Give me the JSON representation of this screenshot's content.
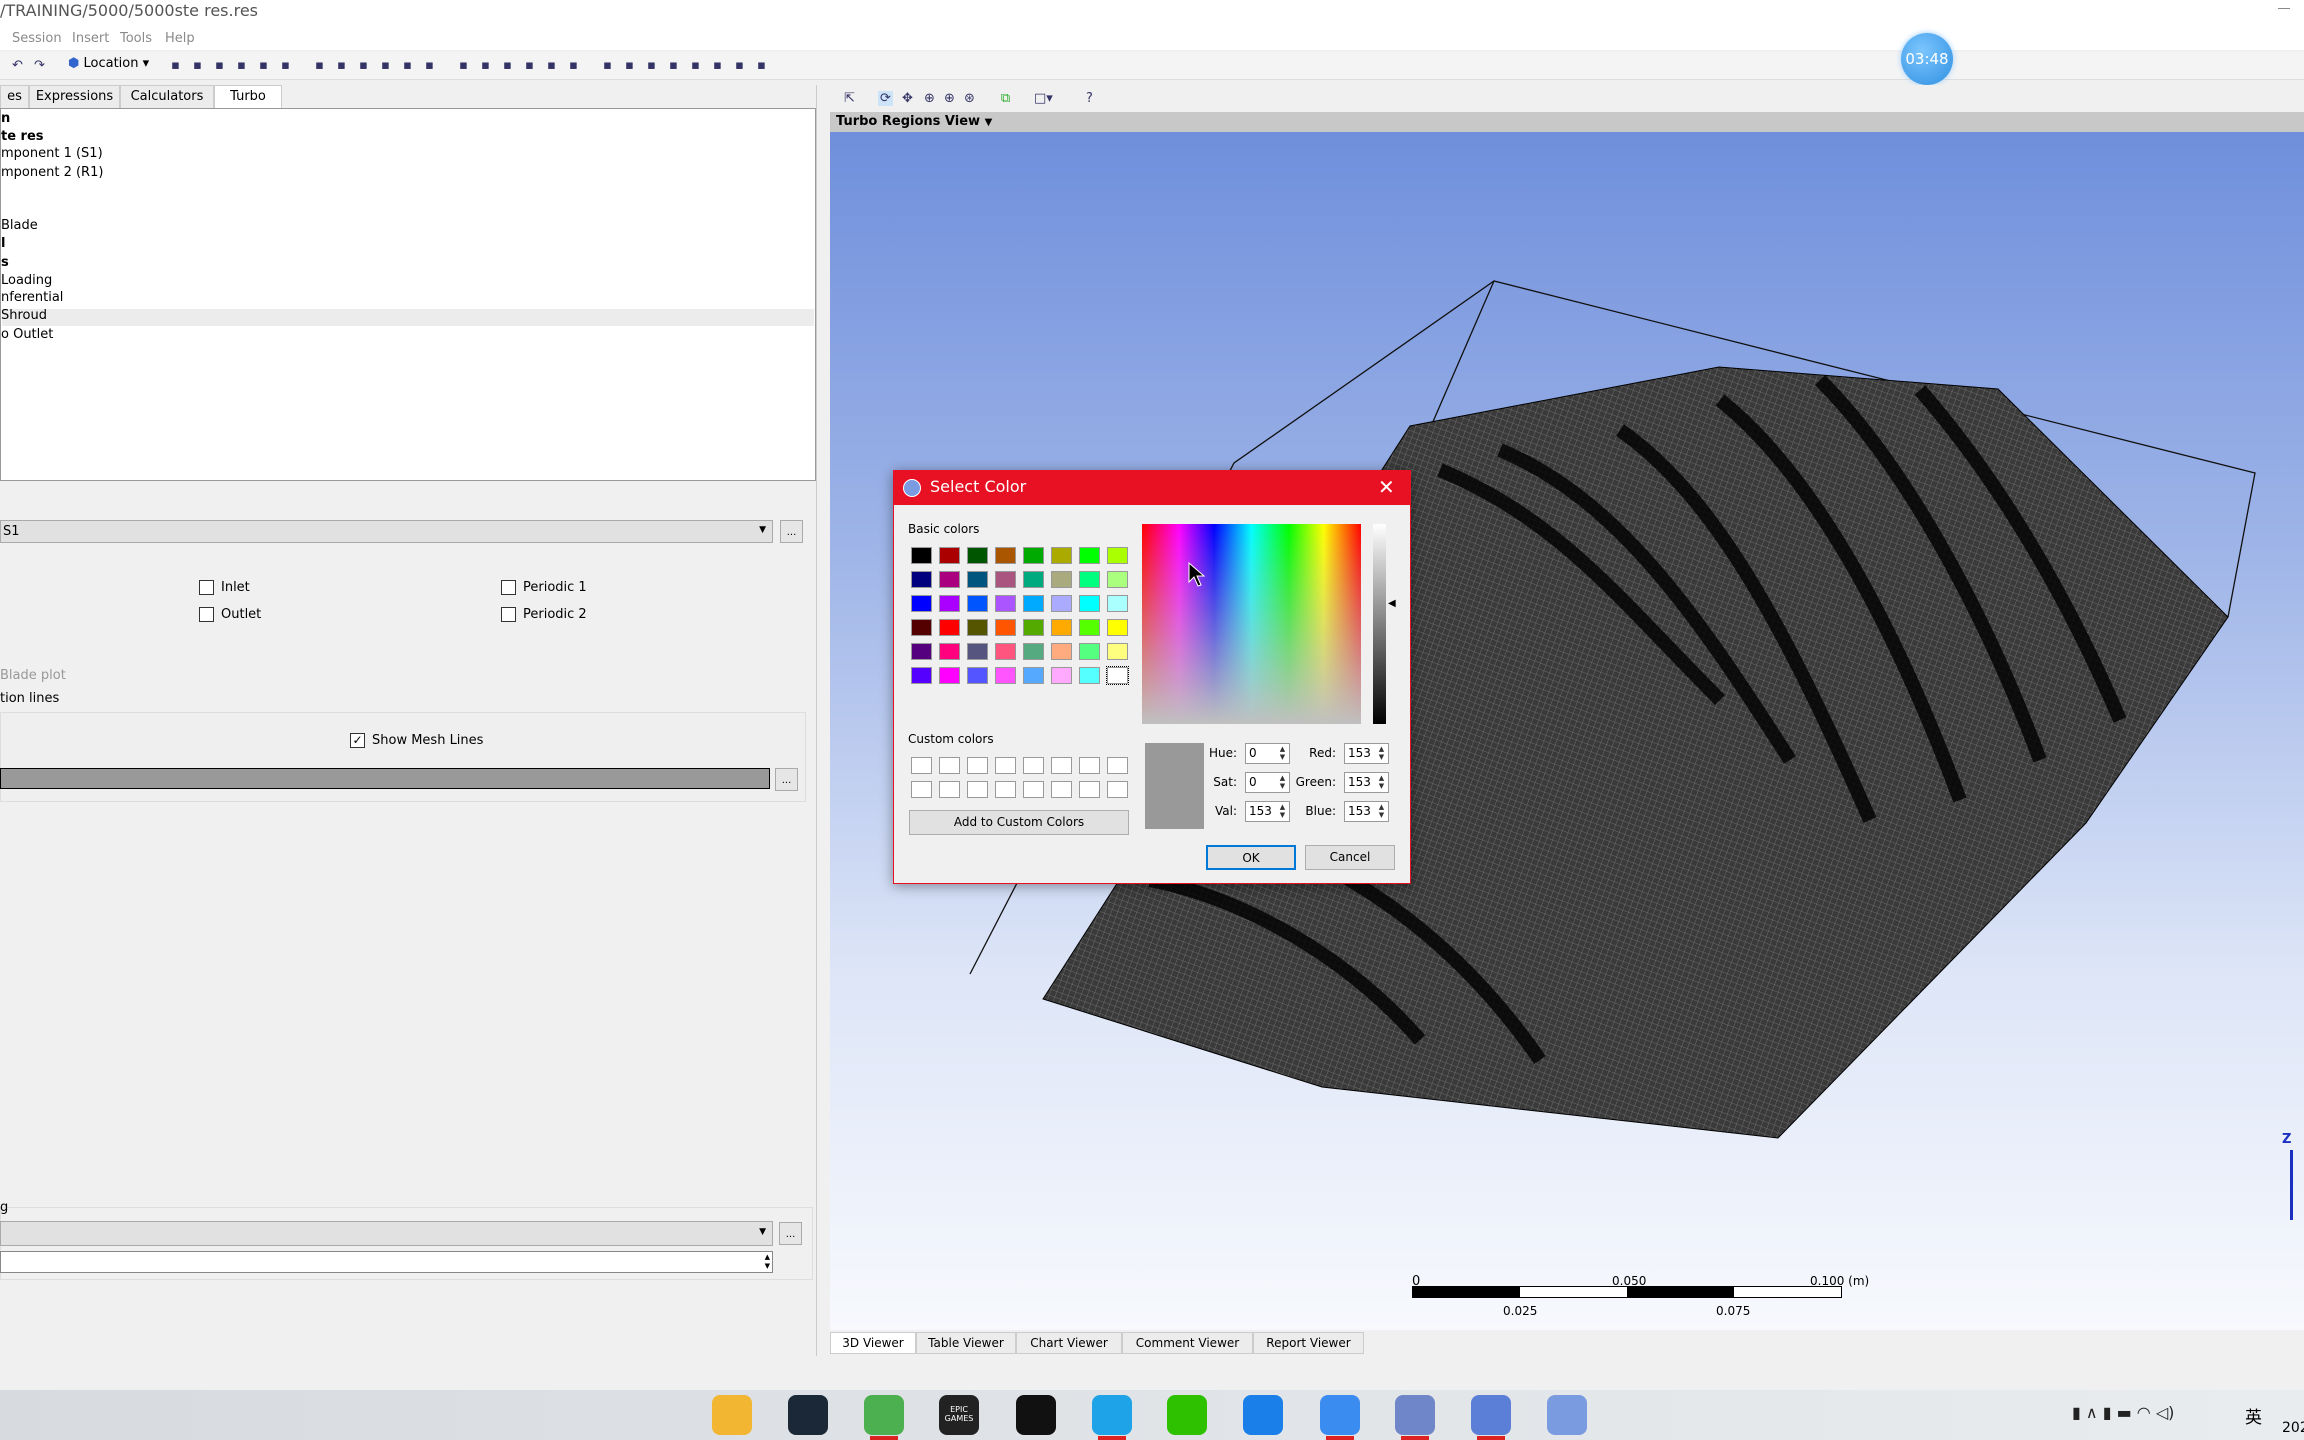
{
  "window": {
    "title": "/TRAINING/5000/5000ste res.res"
  },
  "menu": [
    "Session",
    "Insert",
    "Tools",
    "Help"
  ],
  "toolbar": {
    "location_label": "Location",
    "icons": [
      "undo-icon",
      "redo-icon",
      "vector-icon",
      "contour-icon",
      "streamline-icon",
      "volume-rendering-icon",
      "isosurface-icon",
      "text-icon",
      "coordinate-frame-icon",
      "legend-icon",
      "instance-transform-icon",
      "clip-plane-icon",
      "color-map-icon",
      "variable-icon",
      "expression-icon",
      "table-icon",
      "chart-icon",
      "comment-icon",
      "report-icon",
      "timestep-icon",
      "animation-icon",
      "quick-editor-icon",
      "probe-icon",
      "function-calculator-icon",
      "macro-calculator-icon",
      "mesh-calculator-icon",
      "case-comparison-icon",
      "command-editor-icon"
    ]
  },
  "timer": "03:48",
  "left_tabs": [
    "es",
    "Expressions",
    "Calculators",
    "Turbo"
  ],
  "left_active_tab": "Turbo",
  "tree": {
    "items": [
      {
        "label": "n",
        "bold": true
      },
      {
        "label": "te res",
        "bold": true
      },
      {
        "label": "mponent 1 (S1)",
        "bold": false
      },
      {
        "label": "mponent 2 (R1)",
        "bold": false
      }
    ],
    "items2": [
      {
        "label": "Blade",
        "bold": false
      },
      {
        "label": "l",
        "bold": true
      },
      {
        "label": "s",
        "bold": true
      },
      {
        "label": "Loading",
        "bold": false
      },
      {
        "label": "nferential",
        "bold": false
      },
      {
        "label": " Shroud",
        "bold": false
      },
      {
        "label": "o Outlet",
        "bold": false
      }
    ]
  },
  "details": {
    "domain_select": "S1",
    "checkboxes": [
      {
        "label": "Inlet",
        "checked": false
      },
      {
        "label": "Outlet",
        "checked": false
      },
      {
        "label": "Periodic 1",
        "checked": false
      },
      {
        "label": "Periodic 2",
        "checked": false
      }
    ],
    "blade_plot_label": "Blade plot",
    "lines_label": "tion lines",
    "show_mesh_lines": {
      "label": "Show Mesh Lines",
      "checked": true
    },
    "mesh_color": "#999999",
    "bottom_group_label": "g",
    "bottom_select": "",
    "bottom_spinner": "",
    "dots": "..."
  },
  "viewer": {
    "view_name": "Turbo Regions View",
    "tabs": [
      "3D Viewer",
      "Table Viewer",
      "Chart Viewer",
      "Comment Viewer",
      "Report Viewer"
    ],
    "active_tab": "3D Viewer",
    "scale": {
      "top": [
        "0",
        "0.050",
        "0.100 (m)"
      ],
      "bottom": [
        "0.025",
        "0.075"
      ]
    },
    "axis_label": "Z"
  },
  "dialog": {
    "title": "Select Color",
    "basic_label": "Basic colors",
    "custom_label": "Custom colors",
    "add_custom": "Add to Custom Colors",
    "basic_colors": [
      [
        "#000000",
        "#aa0000",
        "#005500",
        "#aa5500",
        "#00aa00",
        "#aaaa00",
        "#00ff00",
        "#aaff00"
      ],
      [
        "#00007f",
        "#aa007f",
        "#00557f",
        "#aa557f",
        "#00aa7f",
        "#aaaa7f",
        "#00ff7f",
        "#aaff7f"
      ],
      [
        "#0000ff",
        "#aa00ff",
        "#0055ff",
        "#aa55ff",
        "#00aaff",
        "#aaaaff",
        "#00ffff",
        "#aaffff"
      ],
      [
        "#550000",
        "#ff0000",
        "#555500",
        "#ff5500",
        "#55aa00",
        "#ffaa00",
        "#55ff00",
        "#ffff00"
      ],
      [
        "#55007f",
        "#ff007f",
        "#55557f",
        "#ff557f",
        "#55aa7f",
        "#ffaa7f",
        "#55ff7f",
        "#ffff7f"
      ],
      [
        "#5500ff",
        "#ff00ff",
        "#5555ff",
        "#ff55ff",
        "#55aaff",
        "#ffaaff",
        "#55ffff",
        "#ffffff"
      ]
    ],
    "selected_basic": "#ffffff",
    "current_color": "#999999",
    "hue_label": "Hue:",
    "hue": "0",
    "sat_label": "Sat:",
    "sat": "0",
    "val_label": "Val:",
    "val": "153",
    "red_label": "Red:",
    "red": "153",
    "green_label": "Green:",
    "green": "153",
    "blue_label": "Blue:",
    "blue": "153",
    "ok": "OK",
    "cancel": "Cancel"
  },
  "taskbar": {
    "apps": [
      "file-explorer",
      "steam",
      "browser-e",
      "epic-games",
      "qq",
      "video-player",
      "wechat",
      "k-app",
      "feishu",
      "app-gear",
      "arrow-app",
      "cfd-post"
    ],
    "epic_label": "EPIC GAMES",
    "tray_ime": "英",
    "clock_partial": "202"
  }
}
